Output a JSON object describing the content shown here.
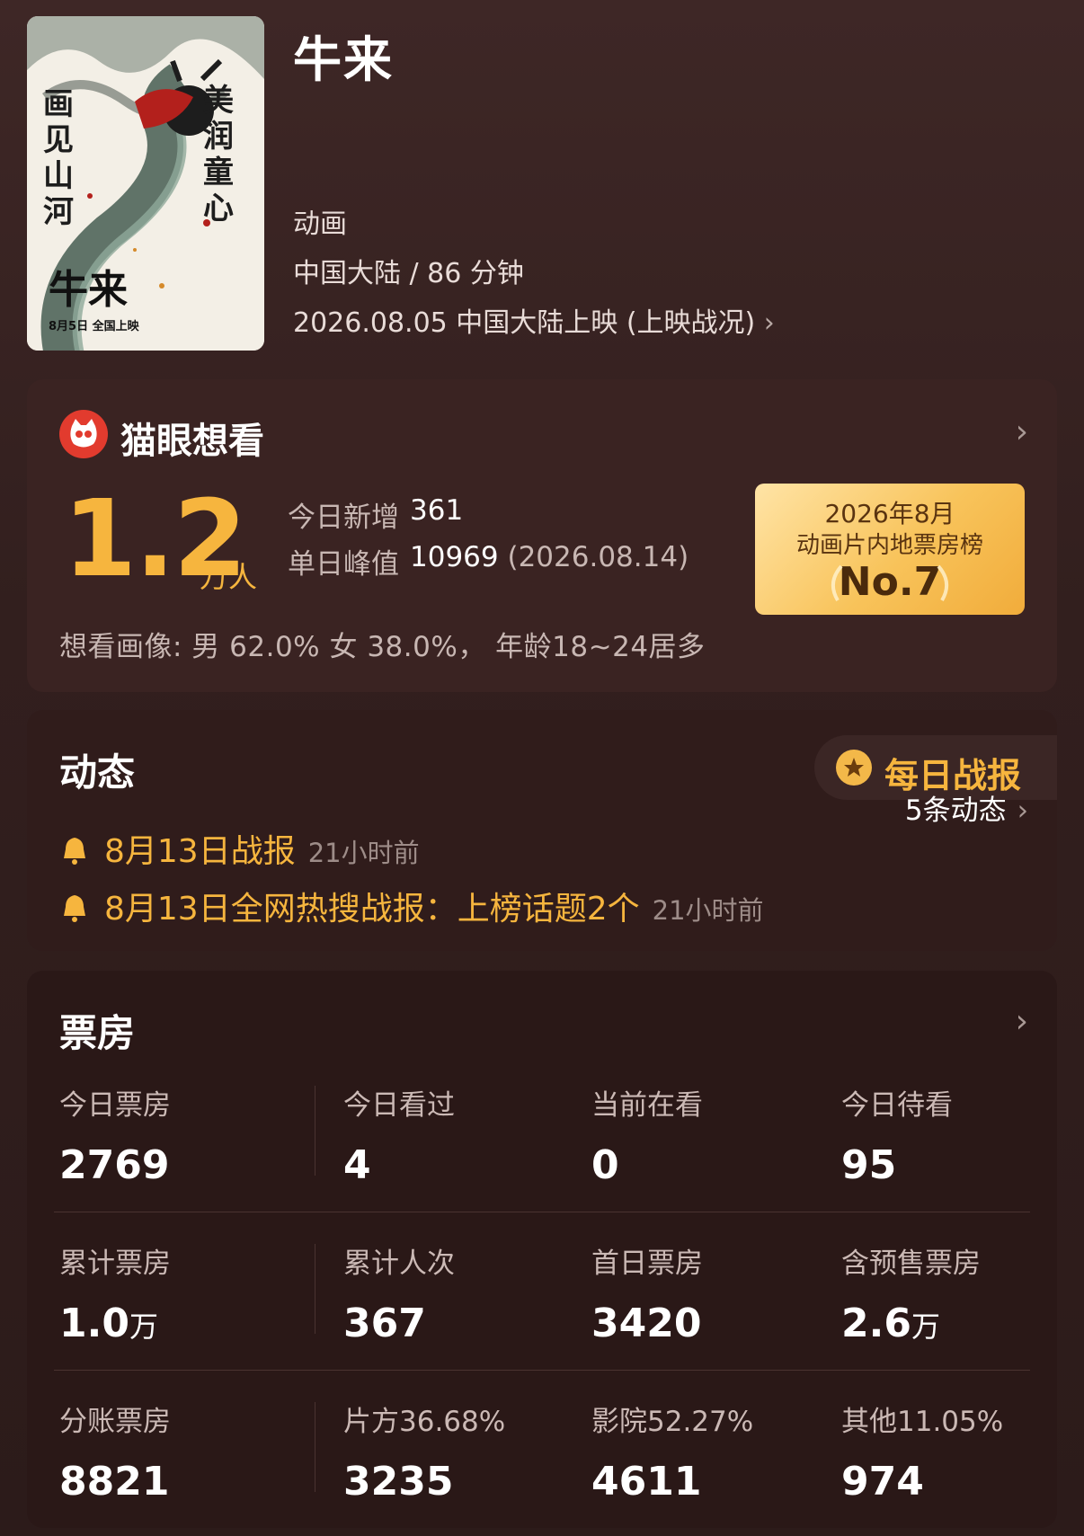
{
  "movie": {
    "title": "牛来",
    "genre": "动画",
    "region_duration": "中国大陆 / 86 分钟",
    "release": "2026.08.05 中国大陆上映 (上映战况)",
    "poster_text": {
      "left_vertical": "画见山河",
      "right_vertical": "美润童心",
      "logo": "牛来",
      "date_line": "8月5日 全国上映"
    }
  },
  "wish": {
    "title": "猫眼想看",
    "count": "1.2",
    "unit": "万人",
    "today_label": "今日新增",
    "today_value": "361",
    "peak_label": "单日峰值",
    "peak_value": "10969",
    "peak_date": "(2026.08.14)",
    "portrait": "想看画像: 男 62.0%  女 38.0%， 年龄18~24居多",
    "badge": {
      "line1": "2026年8月",
      "line2": "动画片内地票房榜",
      "rank": "No.7"
    }
  },
  "news": {
    "title": "动态",
    "daily_report": "每日战报",
    "items": [
      {
        "text": "8月13日战报",
        "time": "21小时前"
      },
      {
        "text": "8月13日全网热搜战报：上榜话题2个",
        "time": "21小时前"
      }
    ],
    "more": "5条动态"
  },
  "box_office": {
    "title": "票房",
    "rows": [
      [
        {
          "label": "今日票房",
          "value": "2769",
          "unit": ""
        },
        {
          "label": "今日看过",
          "value": "4",
          "unit": ""
        },
        {
          "label": "当前在看",
          "value": "0",
          "unit": ""
        },
        {
          "label": "今日待看",
          "value": "95",
          "unit": ""
        }
      ],
      [
        {
          "label": "累计票房",
          "value": "1.0",
          "unit": "万"
        },
        {
          "label": "累计人次",
          "value": "367",
          "unit": ""
        },
        {
          "label": "首日票房",
          "value": "3420",
          "unit": ""
        },
        {
          "label": "含预售票房",
          "value": "2.6",
          "unit": "万"
        }
      ],
      [
        {
          "label": "分账票房",
          "value": "8821",
          "unit": ""
        },
        {
          "label": "片方36.68%",
          "value": "3235",
          "unit": ""
        },
        {
          "label": "影院52.27%",
          "value": "4611",
          "unit": ""
        },
        {
          "label": "其他11.05%",
          "value": "974",
          "unit": ""
        }
      ]
    ]
  },
  "colors": {
    "accent": "#f6b53e",
    "background": "#321f1e",
    "brand_red": "#e23b2e"
  }
}
